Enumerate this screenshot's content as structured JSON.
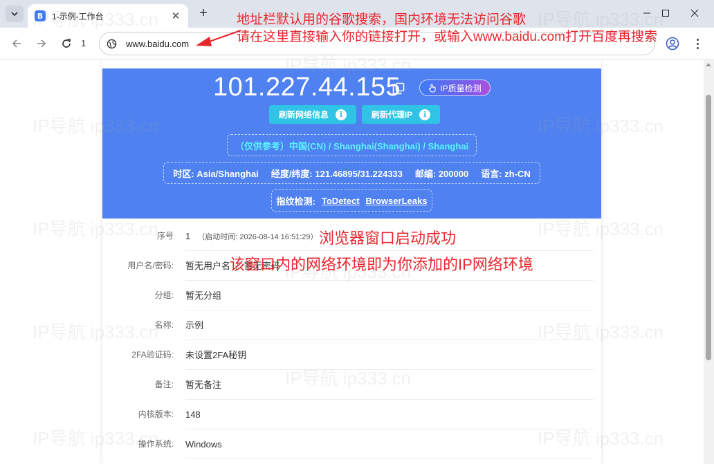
{
  "browser": {
    "tab_title": "1-示例-工作台",
    "tab_favicon_letter": "B",
    "url": "www.baidu.com",
    "nav_number": "1"
  },
  "annotations": {
    "top_line1": "地址栏默认用的谷歌搜索，国内环境无法访问谷歌",
    "top_line2": "请在这里直接输入你的链接打开，或输入www.baidu.com打开百度再搜索",
    "mid_line1": "浏览器窗口启动成功",
    "mid_line2": "该窗口内的网络环境即为你添加的IP网络环境",
    "color": "#e8262d"
  },
  "watermark": "IP导航  ip333.cn",
  "hero": {
    "ip": "101.227.44.155",
    "quality_button": "IP质量检测",
    "refresh_network_button": "刷新网络信息",
    "refresh_proxy_button": "刷新代理IP",
    "location": "（仅供参考）中国(CN) / Shanghai(Shanghai) / Shanghai",
    "timezone": "时区: Asia/Shanghai",
    "coords": "经度/纬度: 121.46895/31.224333",
    "postal": "邮编: 200000",
    "language": "语言: zh-CN",
    "fingerprint_label": "指纹检测:",
    "fingerprint_link1": "ToDetect",
    "fingerprint_link2": "BrowserLeaks",
    "colors": {
      "background": "#4f81f0",
      "button": "#2fc3e5",
      "location_text": "#59f5ff"
    }
  },
  "rows": [
    {
      "label": "序号",
      "value": "1",
      "sub": "（启动时间: 2026-08-14 16:51:29）"
    },
    {
      "label": "用户名/密码:",
      "value": "暂无用户名",
      "sep": "/",
      "value2": "暂无密码"
    },
    {
      "label": "分组:",
      "value": "暂无分组"
    },
    {
      "label": "名称:",
      "value": "示例"
    },
    {
      "label": "2FA验证码:",
      "value": "未设置2FA秘钥"
    },
    {
      "label": "备注:",
      "value": "暂无备注"
    },
    {
      "label": "内核版本:",
      "value": "148"
    },
    {
      "label": "操作系统:",
      "value": "Windows"
    }
  ]
}
